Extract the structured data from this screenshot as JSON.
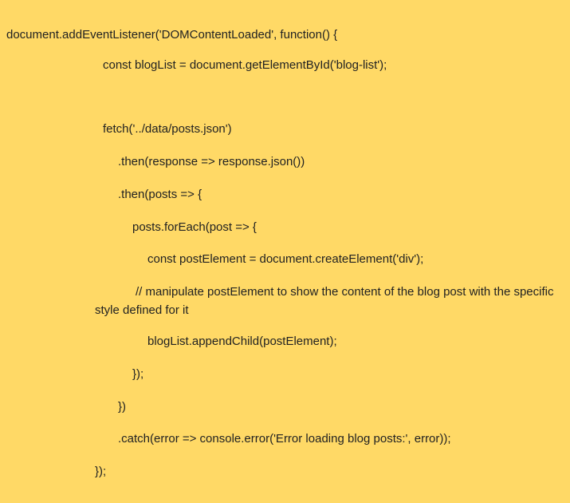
{
  "code_lines": [
    "document.addEventListener('DOMContentLoaded', function() {",
    "const blogList = document.getElementById('blog-list');",
    "fetch('../data/posts.json')",
    ".then(response => response.json())",
    ".then(posts => {",
    "posts.forEach(post => {",
    "const postElement = document.createElement('div');",
    "// manipulate postElement to show the content of the blog post with the specific style defined for it",
    "blogList.appendChild(postElement);",
    "});",
    "})",
    ".catch(error => console.error('Error loading blog posts:', error));",
    "});"
  ]
}
